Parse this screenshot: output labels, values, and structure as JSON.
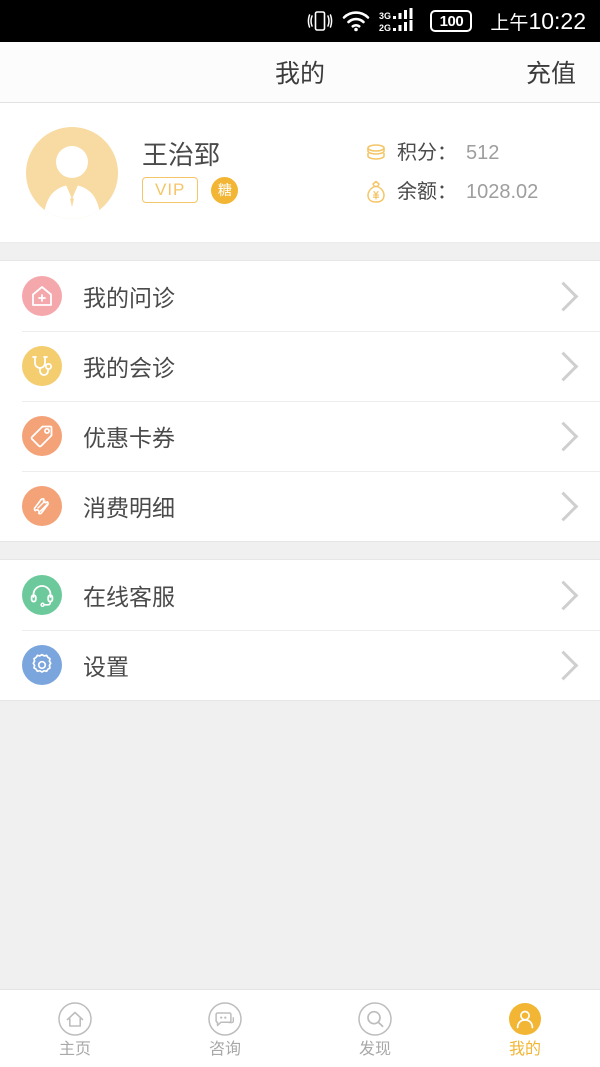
{
  "status_bar": {
    "icons": [
      "vibrate-icon",
      "wifi-icon",
      "signal-3g-2g-icon"
    ],
    "battery_level": "100",
    "time": "10:22",
    "ampm": "上午"
  },
  "header": {
    "title": "我的",
    "action_label": "充值"
  },
  "profile": {
    "avatar_icon": "user-avatar-icon",
    "name": "王治郅",
    "vip_badge": "VIP",
    "tang_badge": "糖",
    "stats": [
      {
        "icon": "coins-icon",
        "label": "积分：",
        "value": "512"
      },
      {
        "icon": "money-bag-icon",
        "label": "余额：",
        "value": "1028.02"
      }
    ]
  },
  "menu_groups": [
    {
      "items": [
        {
          "icon": "hospital-icon",
          "label": "我的问诊",
          "color": "#f5a8ac"
        },
        {
          "icon": "stethoscope-icon",
          "label": "我的会诊",
          "color": "#f3cd6e"
        },
        {
          "icon": "tag-icon",
          "label": "优惠卡券",
          "color": "#f4a277"
        },
        {
          "icon": "ticket-icon",
          "label": "消费明细",
          "color": "#f4a277"
        }
      ]
    },
    {
      "items": [
        {
          "icon": "headset-icon",
          "label": "在线客服",
          "color": "#6cc99b"
        },
        {
          "icon": "gear-icon",
          "label": "设置",
          "color": "#7ba5dd"
        }
      ]
    }
  ],
  "tabbar": {
    "active_color": "#f2b534",
    "items": [
      {
        "icon": "home-icon",
        "label": "主页",
        "active": false
      },
      {
        "icon": "chat-icon",
        "label": "咨询",
        "active": false
      },
      {
        "icon": "search-icon",
        "label": "发现",
        "active": false
      },
      {
        "icon": "person-icon",
        "label": "我的",
        "active": true
      }
    ]
  }
}
